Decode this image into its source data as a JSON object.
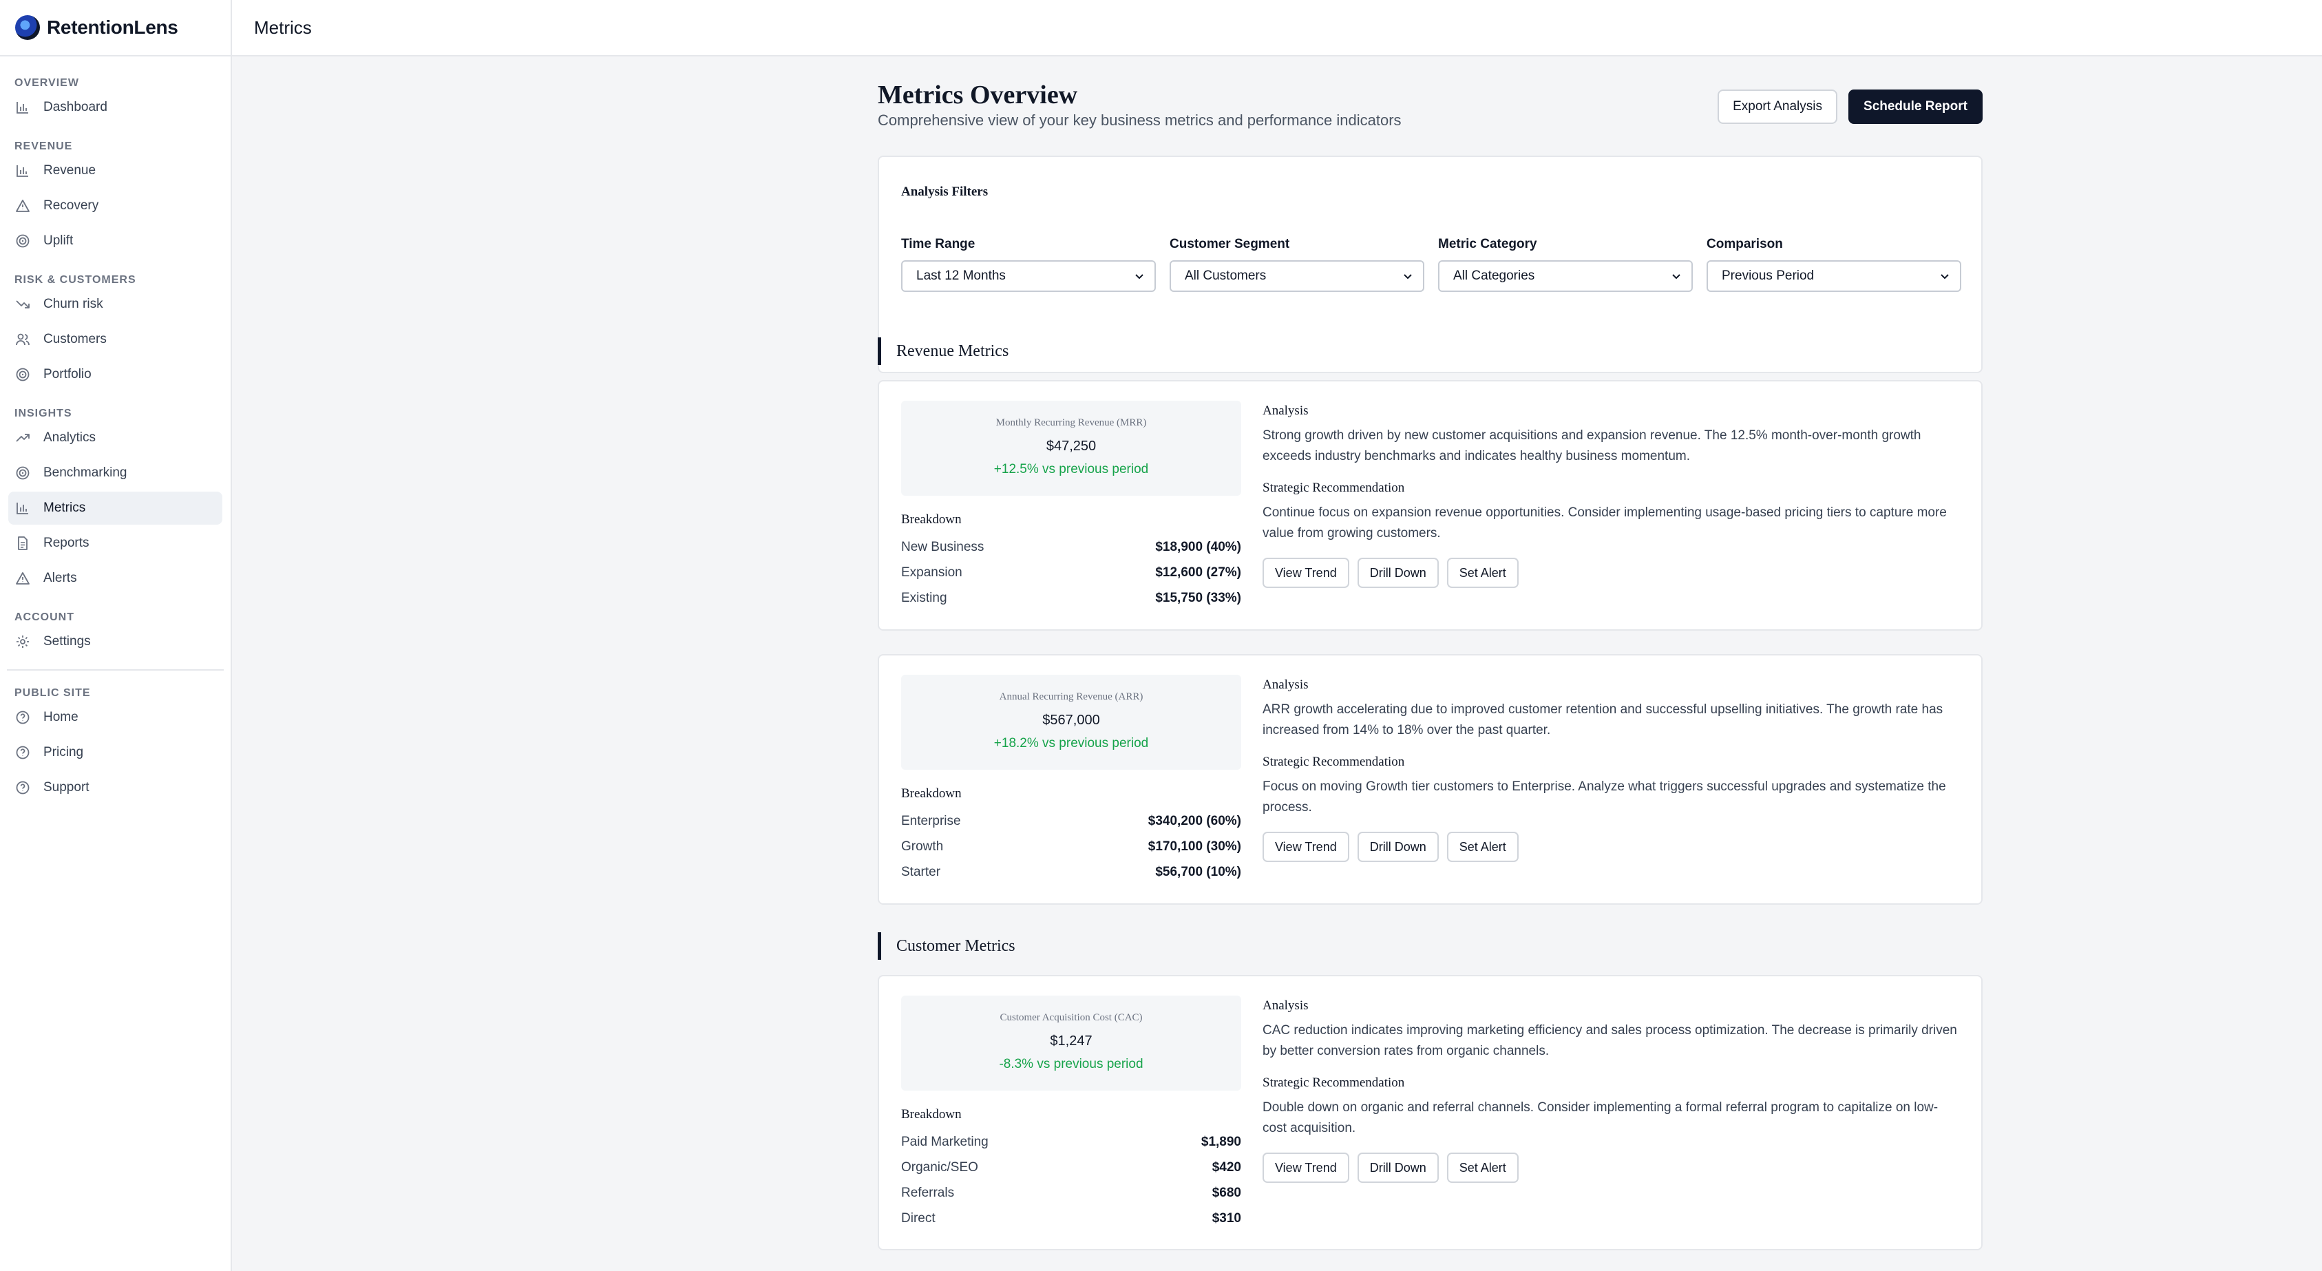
{
  "app": {
    "name": "RetentionLens"
  },
  "topbar": {
    "title": "Metrics"
  },
  "sidebar": {
    "sections": [
      {
        "label": "OVERVIEW",
        "items": [
          {
            "label": "Dashboard",
            "icon": "bar-chart-icon"
          }
        ]
      },
      {
        "label": "REVENUE",
        "items": [
          {
            "label": "Revenue",
            "icon": "bar-chart-icon"
          },
          {
            "label": "Recovery",
            "icon": "warning-icon"
          },
          {
            "label": "Uplift",
            "icon": "target-icon"
          }
        ]
      },
      {
        "label": "RISK & CUSTOMERS",
        "items": [
          {
            "label": "Churn risk",
            "icon": "trend-down-icon"
          },
          {
            "label": "Customers",
            "icon": "users-icon"
          },
          {
            "label": "Portfolio",
            "icon": "target-icon"
          }
        ]
      },
      {
        "label": "INSIGHTS",
        "items": [
          {
            "label": "Analytics",
            "icon": "trend-up-icon"
          },
          {
            "label": "Benchmarking",
            "icon": "target-icon"
          },
          {
            "label": "Metrics",
            "icon": "bar-chart-icon",
            "active": true
          },
          {
            "label": "Reports",
            "icon": "document-icon"
          },
          {
            "label": "Alerts",
            "icon": "warning-icon"
          }
        ]
      },
      {
        "label": "ACCOUNT",
        "items": [
          {
            "label": "Settings",
            "icon": "gear-icon"
          }
        ]
      },
      {
        "label": "PUBLIC SITE",
        "items": [
          {
            "label": "Home",
            "icon": "help-circle-icon"
          },
          {
            "label": "Pricing",
            "icon": "help-circle-icon"
          },
          {
            "label": "Support",
            "icon": "help-circle-icon"
          }
        ]
      }
    ]
  },
  "page": {
    "title": "Metrics Overview",
    "subtitle": "Comprehensive view of your key business metrics and performance indicators",
    "export_label": "Export Analysis",
    "schedule_label": "Schedule Report"
  },
  "filters": {
    "title": "Analysis Filters",
    "time_range": {
      "label": "Time Range",
      "value": "Last 12 Months"
    },
    "segment": {
      "label": "Customer Segment",
      "value": "All Customers"
    },
    "category": {
      "label": "Metric Category",
      "value": "All Categories"
    },
    "comparison": {
      "label": "Comparison",
      "value": "Previous Period"
    }
  },
  "sections": {
    "revenue": "Revenue Metrics",
    "customer": "Customer Metrics"
  },
  "labels": {
    "breakdown": "Breakdown",
    "analysis": "Analysis",
    "recommendation": "Strategic Recommendation",
    "view_trend": "View Trend",
    "drill_down": "Drill Down",
    "set_alert": "Set Alert"
  },
  "metrics": [
    {
      "name": "Monthly Recurring Revenue (MRR)",
      "value": "$47,250",
      "change": "+12.5% vs previous period",
      "breakdown": [
        {
          "label": "New Business",
          "value": "$18,900 (40%)"
        },
        {
          "label": "Expansion",
          "value": "$12,600 (27%)"
        },
        {
          "label": "Existing",
          "value": "$15,750 (33%)"
        }
      ],
      "analysis": "Strong growth driven by new customer acquisitions and expansion revenue. The 12.5% month-over-month growth exceeds industry benchmarks and indicates healthy business momentum.",
      "recommendation": "Continue focus on expansion revenue opportunities. Consider implementing usage-based pricing tiers to capture more value from growing customers."
    },
    {
      "name": "Annual Recurring Revenue (ARR)",
      "value": "$567,000",
      "change": "+18.2% vs previous period",
      "breakdown": [
        {
          "label": "Enterprise",
          "value": "$340,200 (60%)"
        },
        {
          "label": "Growth",
          "value": "$170,100 (30%)"
        },
        {
          "label": "Starter",
          "value": "$56,700 (10%)"
        }
      ],
      "analysis": "ARR growth accelerating due to improved customer retention and successful upselling initiatives. The growth rate has increased from 14% to 18% over the past quarter.",
      "recommendation": "Focus on moving Growth tier customers to Enterprise. Analyze what triggers successful upgrades and systematize the process."
    },
    {
      "name": "Customer Acquisition Cost (CAC)",
      "value": "$1,247",
      "change": "-8.3% vs previous period",
      "breakdown": [
        {
          "label": "Paid Marketing",
          "value": "$1,890"
        },
        {
          "label": "Organic/SEO",
          "value": "$420"
        },
        {
          "label": "Referrals",
          "value": "$680"
        },
        {
          "label": "Direct",
          "value": "$310"
        }
      ],
      "analysis": "CAC reduction indicates improving marketing efficiency and sales process optimization. The decrease is primarily driven by better conversion rates from organic channels.",
      "recommendation": "Double down on organic and referral channels. Consider implementing a formal referral program to capitalize on low-cost acquisition."
    }
  ]
}
